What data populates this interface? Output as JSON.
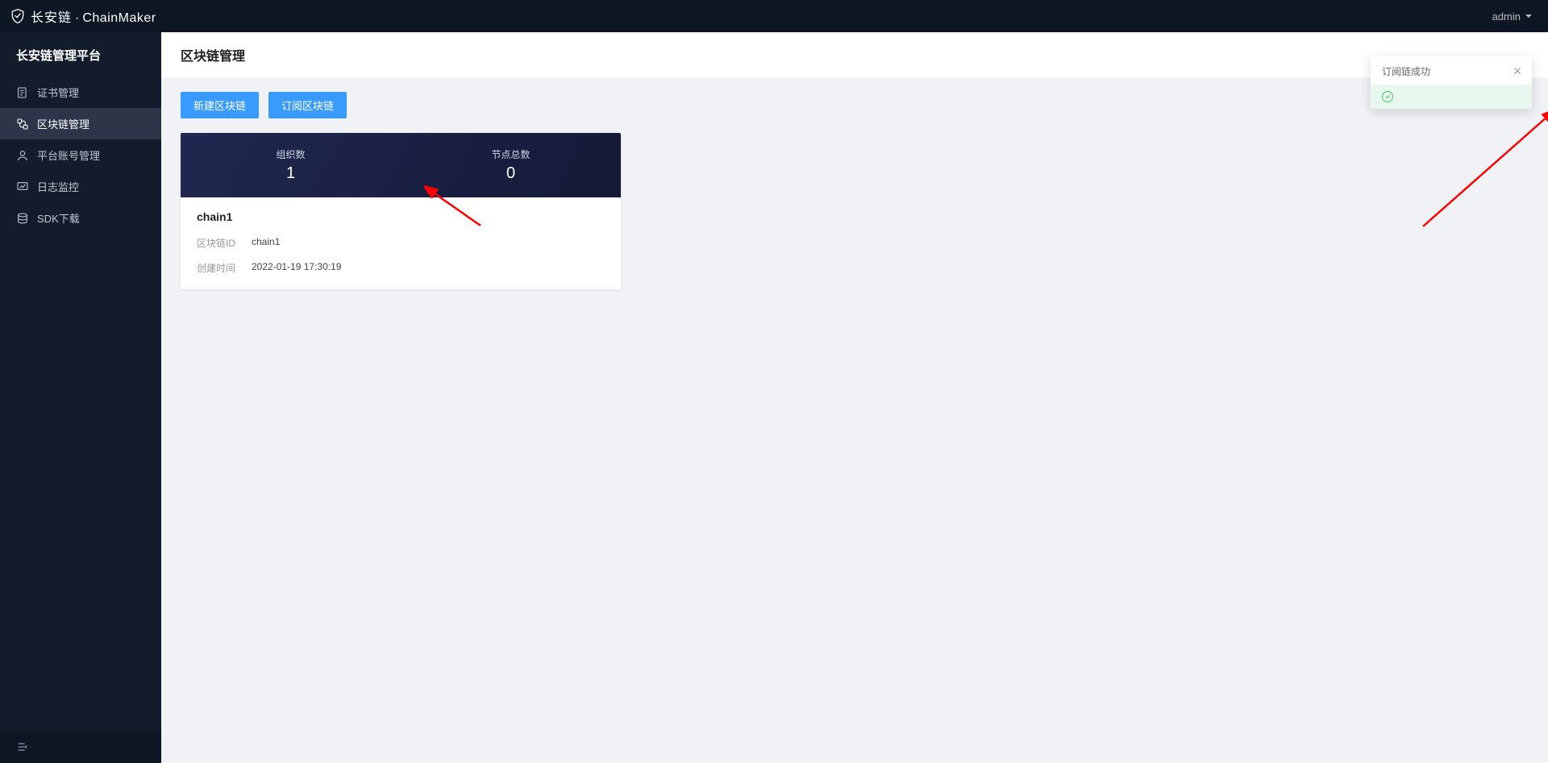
{
  "header": {
    "brand_cn": "长安链",
    "brand_sep": "·",
    "brand_en": "ChainMaker",
    "user_label": "admin"
  },
  "sidebar": {
    "title": "长安链管理平台",
    "items": [
      {
        "id": "cert",
        "label": "证书管理",
        "icon": "doc-icon",
        "active": false
      },
      {
        "id": "chain",
        "label": "区块链管理",
        "icon": "chain-icon",
        "active": true
      },
      {
        "id": "account",
        "label": "平台账号管理",
        "icon": "user-icon",
        "active": false
      },
      {
        "id": "log",
        "label": "日志监控",
        "icon": "monitor-icon",
        "active": false
      },
      {
        "id": "sdk",
        "label": "SDK下载",
        "icon": "download-icon",
        "active": false
      }
    ]
  },
  "content": {
    "title": "区块链管理",
    "buttons": {
      "new_chain": "新建区块链",
      "subscribe_chain": "订阅区块链"
    },
    "card": {
      "stats": {
        "org_label": "组织数",
        "org_value": "1",
        "node_label": "节点总数",
        "node_value": "0"
      },
      "name": "chain1",
      "rows": {
        "id_label": "区块链ID",
        "id_value": "chain1",
        "time_label": "创建时间",
        "time_value": "2022-01-19 17:30:19"
      }
    }
  },
  "toast": {
    "title": "订阅链成功"
  }
}
